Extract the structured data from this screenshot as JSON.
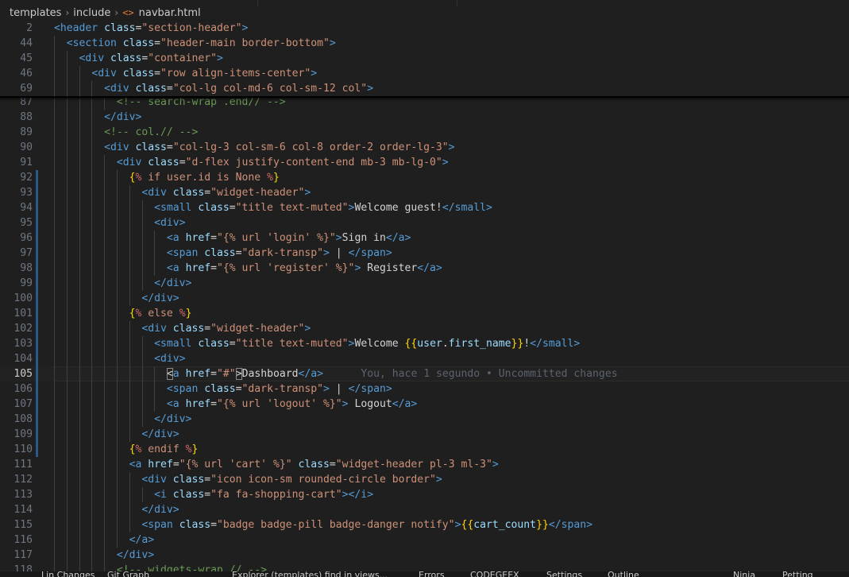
{
  "breadcrumb": {
    "segments": [
      "templates",
      "include"
    ],
    "file_icon": "<>",
    "file_name": "navbar.html",
    "separator": "›"
  },
  "editor": {
    "current_line": 105,
    "blame": "You, hace 1 segundo • Uncommitted changes",
    "sticky_lines": [
      {
        "num": "2",
        "indent": 0,
        "tokens": [
          [
            "tag",
            "<header "
          ],
          [
            "attr",
            "class"
          ],
          [
            "eq",
            "="
          ],
          [
            "str",
            "\"section-header\""
          ],
          [
            "tag",
            ">"
          ]
        ]
      },
      {
        "num": "44",
        "indent": 1,
        "tokens": [
          [
            "tag",
            "<section "
          ],
          [
            "attr",
            "class"
          ],
          [
            "eq",
            "="
          ],
          [
            "str",
            "\"header-main border-bottom\""
          ],
          [
            "tag",
            ">"
          ]
        ]
      },
      {
        "num": "45",
        "indent": 2,
        "tokens": [
          [
            "tag",
            "<div "
          ],
          [
            "attr",
            "class"
          ],
          [
            "eq",
            "="
          ],
          [
            "str",
            "\"container\""
          ],
          [
            "tag",
            ">"
          ]
        ]
      },
      {
        "num": "46",
        "indent": 3,
        "tokens": [
          [
            "tag",
            "<div "
          ],
          [
            "attr",
            "class"
          ],
          [
            "eq",
            "="
          ],
          [
            "str",
            "\"row align-items-center\""
          ],
          [
            "tag",
            ">"
          ]
        ]
      },
      {
        "num": "69",
        "indent": 4,
        "tokens": [
          [
            "tag",
            "<div "
          ],
          [
            "attr",
            "class"
          ],
          [
            "eq",
            "="
          ],
          [
            "str",
            "\"col-lg col-md-6 col-sm-12 col\""
          ],
          [
            "tag",
            ">"
          ]
        ]
      }
    ],
    "lines": [
      {
        "num": "87",
        "indent": 5,
        "mod": false,
        "tokens": [
          [
            "cmt",
            "<!-- search-wrap .end// -->"
          ]
        ]
      },
      {
        "num": "88",
        "indent": 4,
        "mod": false,
        "tokens": [
          [
            "tag",
            "</div>"
          ]
        ]
      },
      {
        "num": "89",
        "indent": 4,
        "mod": false,
        "tokens": [
          [
            "cmt",
            "<!-- col.// -->"
          ]
        ]
      },
      {
        "num": "90",
        "indent": 4,
        "mod": false,
        "tokens": [
          [
            "tag",
            "<div "
          ],
          [
            "attr",
            "class"
          ],
          [
            "eq",
            "="
          ],
          [
            "str",
            "\"col-lg-3 col-sm-6 col-8 order-2 order-lg-3\""
          ],
          [
            "tag",
            ">"
          ]
        ]
      },
      {
        "num": "91",
        "indent": 5,
        "mod": false,
        "tokens": [
          [
            "tag",
            "<div "
          ],
          [
            "attr",
            "class"
          ],
          [
            "eq",
            "="
          ],
          [
            "str",
            "\"d-flex justify-content-end mb-3 mb-lg-0\""
          ],
          [
            "tag",
            ">"
          ]
        ]
      },
      {
        "num": "92",
        "indent": 6,
        "mod": true,
        "tokens": [
          [
            "brace",
            "{"
          ],
          [
            "kw",
            "% "
          ],
          [
            "str",
            "if user.id is None "
          ],
          [
            "kw",
            "%"
          ],
          [
            "brace",
            "}"
          ]
        ]
      },
      {
        "num": "93",
        "indent": 7,
        "mod": true,
        "tokens": [
          [
            "tag",
            "<div "
          ],
          [
            "attr",
            "class"
          ],
          [
            "eq",
            "="
          ],
          [
            "str",
            "\"widget-header\""
          ],
          [
            "tag",
            ">"
          ]
        ]
      },
      {
        "num": "94",
        "indent": 8,
        "mod": true,
        "tokens": [
          [
            "tag",
            "<small "
          ],
          [
            "attr",
            "class"
          ],
          [
            "eq",
            "="
          ],
          [
            "str",
            "\"title text-muted\""
          ],
          [
            "tag",
            ">"
          ],
          [
            "text",
            "Welcome guest!"
          ],
          [
            "tag",
            "</small>"
          ]
        ]
      },
      {
        "num": "95",
        "indent": 8,
        "mod": true,
        "tokens": [
          [
            "tag",
            "<div>"
          ]
        ]
      },
      {
        "num": "96",
        "indent": 9,
        "mod": true,
        "tokens": [
          [
            "tag",
            "<a "
          ],
          [
            "attr",
            "href"
          ],
          [
            "eq",
            "="
          ],
          [
            "str",
            "\"{% url 'login' %}\""
          ],
          [
            "tag",
            ">"
          ],
          [
            "text",
            "Sign in"
          ],
          [
            "tag",
            "</a>"
          ]
        ]
      },
      {
        "num": "97",
        "indent": 9,
        "mod": true,
        "tokens": [
          [
            "tag",
            "<span "
          ],
          [
            "attr",
            "class"
          ],
          [
            "eq",
            "="
          ],
          [
            "str",
            "\"dark-transp\""
          ],
          [
            "tag",
            ">"
          ],
          [
            "text",
            " | "
          ],
          [
            "tag",
            "</span>"
          ]
        ]
      },
      {
        "num": "98",
        "indent": 9,
        "mod": true,
        "tokens": [
          [
            "tag",
            "<a "
          ],
          [
            "attr",
            "href"
          ],
          [
            "eq",
            "="
          ],
          [
            "str",
            "\"{% url 'register' %}\""
          ],
          [
            "tag",
            ">"
          ],
          [
            "text",
            " Register"
          ],
          [
            "tag",
            "</a>"
          ]
        ]
      },
      {
        "num": "99",
        "indent": 8,
        "mod": true,
        "tokens": [
          [
            "tag",
            "</div>"
          ]
        ]
      },
      {
        "num": "100",
        "indent": 7,
        "mod": true,
        "tokens": [
          [
            "tag",
            "</div>"
          ]
        ]
      },
      {
        "num": "101",
        "indent": 6,
        "mod": true,
        "tokens": [
          [
            "brace",
            "{"
          ],
          [
            "kw",
            "% "
          ],
          [
            "str",
            "else "
          ],
          [
            "kw",
            "%"
          ],
          [
            "brace",
            "}"
          ]
        ]
      },
      {
        "num": "102",
        "indent": 7,
        "mod": true,
        "tokens": [
          [
            "tag",
            "<div "
          ],
          [
            "attr",
            "class"
          ],
          [
            "eq",
            "="
          ],
          [
            "str",
            "\"widget-header\""
          ],
          [
            "tag",
            ">"
          ]
        ]
      },
      {
        "num": "103",
        "indent": 8,
        "mod": true,
        "tokens": [
          [
            "tag",
            "<small "
          ],
          [
            "attr",
            "class"
          ],
          [
            "eq",
            "="
          ],
          [
            "str",
            "\"title text-muted\""
          ],
          [
            "tag",
            ">"
          ],
          [
            "text",
            "Welcome "
          ],
          [
            "brace",
            "{{"
          ],
          [
            "id",
            "user"
          ],
          [
            "text",
            "."
          ],
          [
            "id",
            "first_name"
          ],
          [
            "brace",
            "}}"
          ],
          [
            "text",
            "!"
          ],
          [
            "tag",
            "</small>"
          ]
        ]
      },
      {
        "num": "104",
        "indent": 8,
        "mod": true,
        "tokens": [
          [
            "tag",
            "<div>"
          ]
        ]
      },
      {
        "num": "105",
        "indent": 9,
        "mod": true,
        "tokens": [
          [
            "cursor",
            "<"
          ],
          [
            "tag",
            "a "
          ],
          [
            "attr",
            "href"
          ],
          [
            "eq",
            "="
          ],
          [
            "str",
            "\"#\""
          ],
          [
            "cursor",
            ">"
          ],
          [
            "text",
            "Dashboard"
          ],
          [
            "tag",
            "</a>"
          ]
        ]
      },
      {
        "num": "106",
        "indent": 9,
        "mod": true,
        "tokens": [
          [
            "tag",
            "<span "
          ],
          [
            "attr",
            "class"
          ],
          [
            "eq",
            "="
          ],
          [
            "str",
            "\"dark-transp\""
          ],
          [
            "tag",
            ">"
          ],
          [
            "text",
            " | "
          ],
          [
            "tag",
            "</span>"
          ]
        ]
      },
      {
        "num": "107",
        "indent": 9,
        "mod": true,
        "tokens": [
          [
            "tag",
            "<a "
          ],
          [
            "attr",
            "href"
          ],
          [
            "eq",
            "="
          ],
          [
            "str",
            "\"{% url 'logout' %}\""
          ],
          [
            "tag",
            ">"
          ],
          [
            "text",
            " Logout"
          ],
          [
            "tag",
            "</a>"
          ]
        ]
      },
      {
        "num": "108",
        "indent": 8,
        "mod": true,
        "tokens": [
          [
            "tag",
            "</div>"
          ]
        ]
      },
      {
        "num": "109",
        "indent": 7,
        "mod": true,
        "tokens": [
          [
            "tag",
            "</div>"
          ]
        ]
      },
      {
        "num": "110",
        "indent": 6,
        "mod": true,
        "tokens": [
          [
            "brace",
            "{"
          ],
          [
            "kw",
            "% "
          ],
          [
            "str",
            "endif "
          ],
          [
            "kw",
            "%"
          ],
          [
            "brace",
            "}"
          ]
        ]
      },
      {
        "num": "111",
        "indent": 6,
        "mod": false,
        "tokens": [
          [
            "tag",
            "<a "
          ],
          [
            "attr",
            "href"
          ],
          [
            "eq",
            "="
          ],
          [
            "str",
            "\"{% url 'cart' %}\" "
          ],
          [
            "attr",
            "class"
          ],
          [
            "eq",
            "="
          ],
          [
            "str",
            "\"widget-header pl-3 ml-3\""
          ],
          [
            "tag",
            ">"
          ]
        ]
      },
      {
        "num": "112",
        "indent": 7,
        "mod": false,
        "tokens": [
          [
            "tag",
            "<div "
          ],
          [
            "attr",
            "class"
          ],
          [
            "eq",
            "="
          ],
          [
            "str",
            "\"icon icon-sm rounded-circle border\""
          ],
          [
            "tag",
            ">"
          ]
        ]
      },
      {
        "num": "113",
        "indent": 8,
        "mod": false,
        "tokens": [
          [
            "tag",
            "<i "
          ],
          [
            "attr",
            "class"
          ],
          [
            "eq",
            "="
          ],
          [
            "str",
            "\"fa fa-shopping-cart\""
          ],
          [
            "tag",
            "></i>"
          ]
        ]
      },
      {
        "num": "114",
        "indent": 7,
        "mod": false,
        "tokens": [
          [
            "tag",
            "</div>"
          ]
        ]
      },
      {
        "num": "115",
        "indent": 7,
        "mod": false,
        "tokens": [
          [
            "tag",
            "<span "
          ],
          [
            "attr",
            "class"
          ],
          [
            "eq",
            "="
          ],
          [
            "str",
            "\"badge badge-pill badge-danger notify\""
          ],
          [
            "tag",
            ">"
          ],
          [
            "brace",
            "{{"
          ],
          [
            "id",
            "cart_count"
          ],
          [
            "brace",
            "}}"
          ],
          [
            "tag",
            "</span>"
          ]
        ]
      },
      {
        "num": "116",
        "indent": 6,
        "mod": false,
        "tokens": [
          [
            "tag",
            "</a>"
          ]
        ]
      },
      {
        "num": "117",
        "indent": 5,
        "mod": false,
        "tokens": [
          [
            "tag",
            "</div>"
          ]
        ]
      },
      {
        "num": "118",
        "indent": 5,
        "mod": false,
        "tokens": [
          [
            "cmt",
            "<!-- widgets-wrap.// -->"
          ]
        ]
      }
    ]
  },
  "status": {
    "items": [
      "Lin Changes",
      "Git Graph",
      "Explorer (templates) find in views...",
      "Errors",
      "CODEGEEX",
      "Settings",
      "Outline",
      "Ninja",
      "Petting"
    ]
  },
  "colors": {
    "background": "#1f1f1f",
    "tag": "#569cd6",
    "attribute": "#9cdcfe",
    "string": "#ce9178",
    "comment": "#6a9955",
    "template_brace": "#ffd700",
    "template_keyword": "#d16969",
    "modified_gutter": "#2b5a8a"
  }
}
